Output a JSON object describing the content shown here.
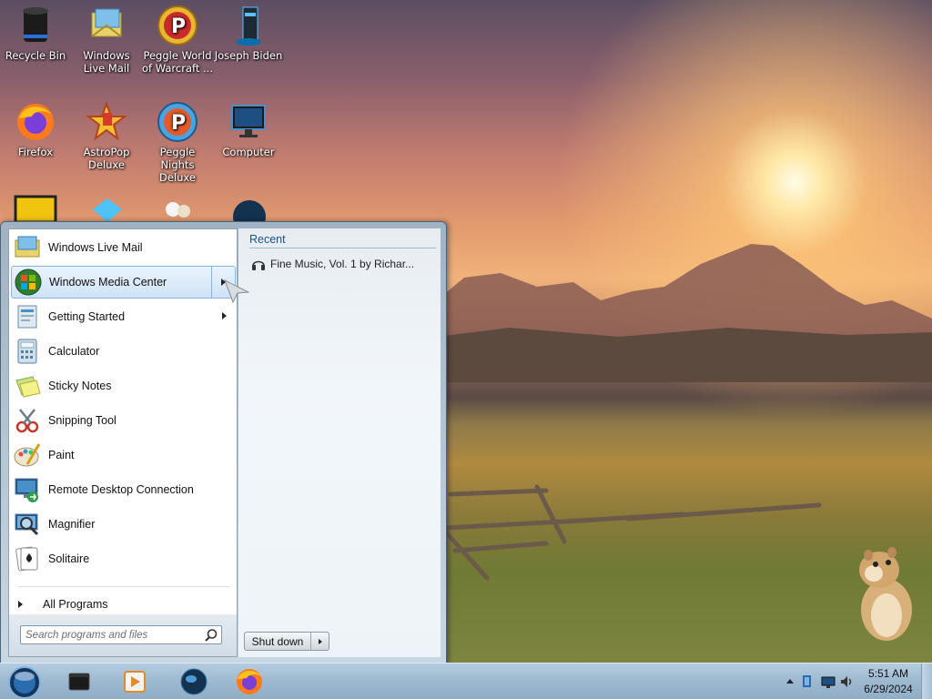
{
  "desktop": {
    "icons": [
      {
        "label": "Recycle Bin",
        "icon": "recycle-bin-icon"
      },
      {
        "label": "Windows Live Mail",
        "icon": "mail-icon"
      },
      {
        "label": "Peggle World of Warcraft ...",
        "icon": "peggle-icon"
      },
      {
        "label": "Joseph Biden",
        "icon": "user-folder-icon"
      },
      {
        "label": "Firefox",
        "icon": "firefox-icon"
      },
      {
        "label": "AstroPop Deluxe",
        "icon": "astropop-icon"
      },
      {
        "label": "Peggle Nights Deluxe",
        "icon": "peggle-nights-icon"
      },
      {
        "label": "Computer",
        "icon": "computer-icon"
      }
    ]
  },
  "start_menu": {
    "programs": [
      {
        "label": "Windows Live Mail",
        "icon": "mail-icon"
      },
      {
        "label": "Windows Media Center",
        "icon": "media-center-icon"
      },
      {
        "label": "Getting Started",
        "icon": "getting-started-icon"
      },
      {
        "label": "Calculator",
        "icon": "calculator-icon"
      },
      {
        "label": "Sticky Notes",
        "icon": "sticky-notes-icon"
      },
      {
        "label": "Snipping Tool",
        "icon": "snipping-tool-icon"
      },
      {
        "label": "Paint",
        "icon": "paint-icon"
      },
      {
        "label": "Remote Desktop Connection",
        "icon": "remote-desktop-icon"
      },
      {
        "label": "Magnifier",
        "icon": "magnifier-icon"
      },
      {
        "label": "Solitaire",
        "icon": "solitaire-icon"
      }
    ],
    "all_programs_label": "All Programs",
    "search_placeholder": "Search programs and files",
    "recent": {
      "header": "Recent",
      "items": [
        {
          "label": "Fine Music, Vol. 1 by Richar...",
          "icon": "headphones-icon"
        }
      ]
    },
    "shutdown_label": "Shut down"
  },
  "taskbar": {
    "clock_time": "5:51 AM",
    "clock_date": "6/29/2024"
  },
  "colors": {
    "start_menu_frame": "#9fb3c5",
    "recent_header": "#1e4f8a",
    "taskbar": "#9fbad1"
  }
}
